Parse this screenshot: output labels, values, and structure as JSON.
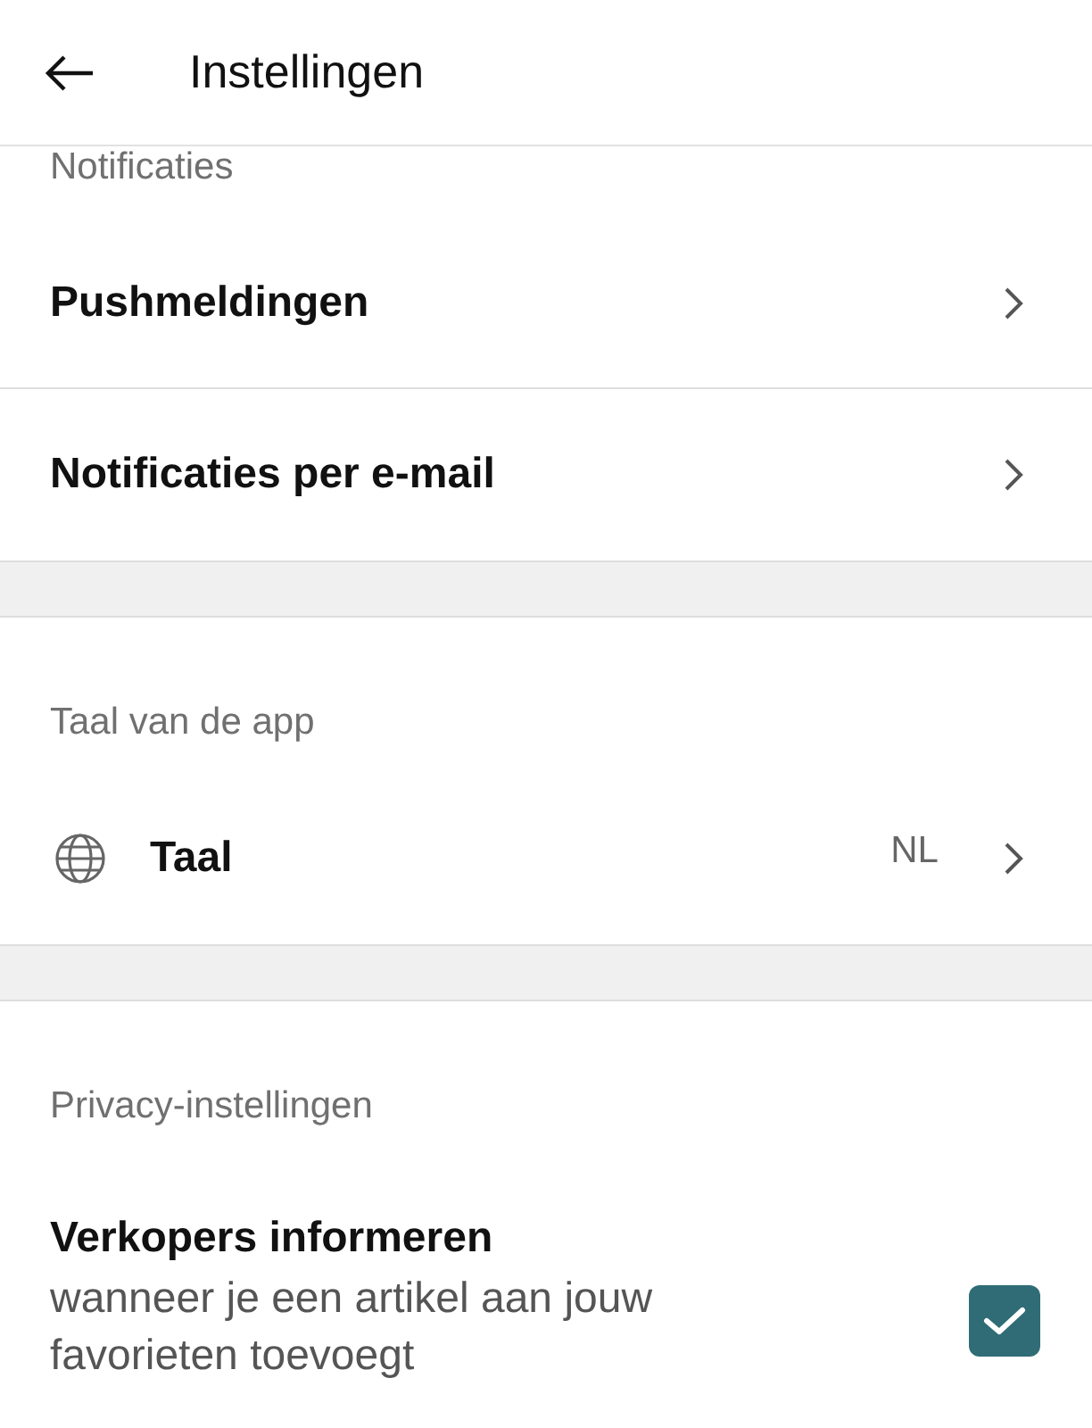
{
  "header": {
    "title": "Instellingen"
  },
  "sections": [
    {
      "label": "Notificaties",
      "items": [
        {
          "kind": "link",
          "title": "Pushmeldingen"
        },
        {
          "kind": "link",
          "title": "Notificaties per e-mail"
        }
      ]
    },
    {
      "label": "Taal van de app",
      "items": [
        {
          "kind": "language",
          "title": "Taal",
          "value": "NL"
        }
      ]
    },
    {
      "label": "Privacy-instellingen",
      "items": [
        {
          "kind": "checkbox",
          "title": "Verkopers informeren",
          "description": "wanneer je een artikel aan jouw favorieten toevoegt",
          "checked": true
        }
      ]
    }
  ]
}
